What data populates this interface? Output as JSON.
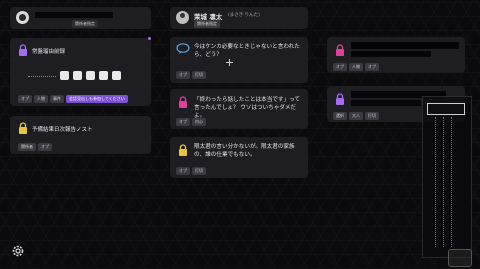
{
  "profile_card": {
    "username": "",
    "level_badge": "関係者指定"
  },
  "header_card": {
    "name": "茉城 凛太",
    "ruby": "(まさき りんた)",
    "badge": "関係者指定"
  },
  "left_cards": [
    {
      "title": "常盤瑠由前録",
      "tags": [
        "オプ",
        "人物",
        "事件"
      ],
      "highlight_tag": "会話見出しも参加してください"
    },
    {
      "title": "予備結果日次報告ノスト",
      "tags": [
        "関係者",
        "オプ"
      ]
    }
  ],
  "messages": [
    {
      "text": "今はケンカ必要なときじゃないと言われたら、どう？",
      "tags": [
        "オプ",
        "打切"
      ]
    },
    {
      "text": "「終わったら話したことは本当です」って言ったんでしょ？ ウソはついちゃダメだよ。",
      "tags": [
        "オプ",
        "内心"
      ]
    },
    {
      "text": "限太君の言い分かないが。限太君の家族の、誰の仕業でもない。",
      "tags": [
        "オプ",
        "打切"
      ]
    }
  ],
  "right_cards": [
    {
      "tags": [
        "オプ",
        "人物",
        "オプ"
      ]
    },
    {
      "tags": [
        "選択",
        "大人",
        "打切"
      ]
    }
  ],
  "colors": {
    "lock_pink": "#e0409a",
    "lock_yellow": "#e8c53a",
    "lock_purple": "#a46cf0",
    "accent_purple": "#7b4fd6"
  },
  "icons": {
    "settings": "gear-icon",
    "crosshair": "crosshair-icon",
    "speech": "speech-bubble-icon"
  }
}
